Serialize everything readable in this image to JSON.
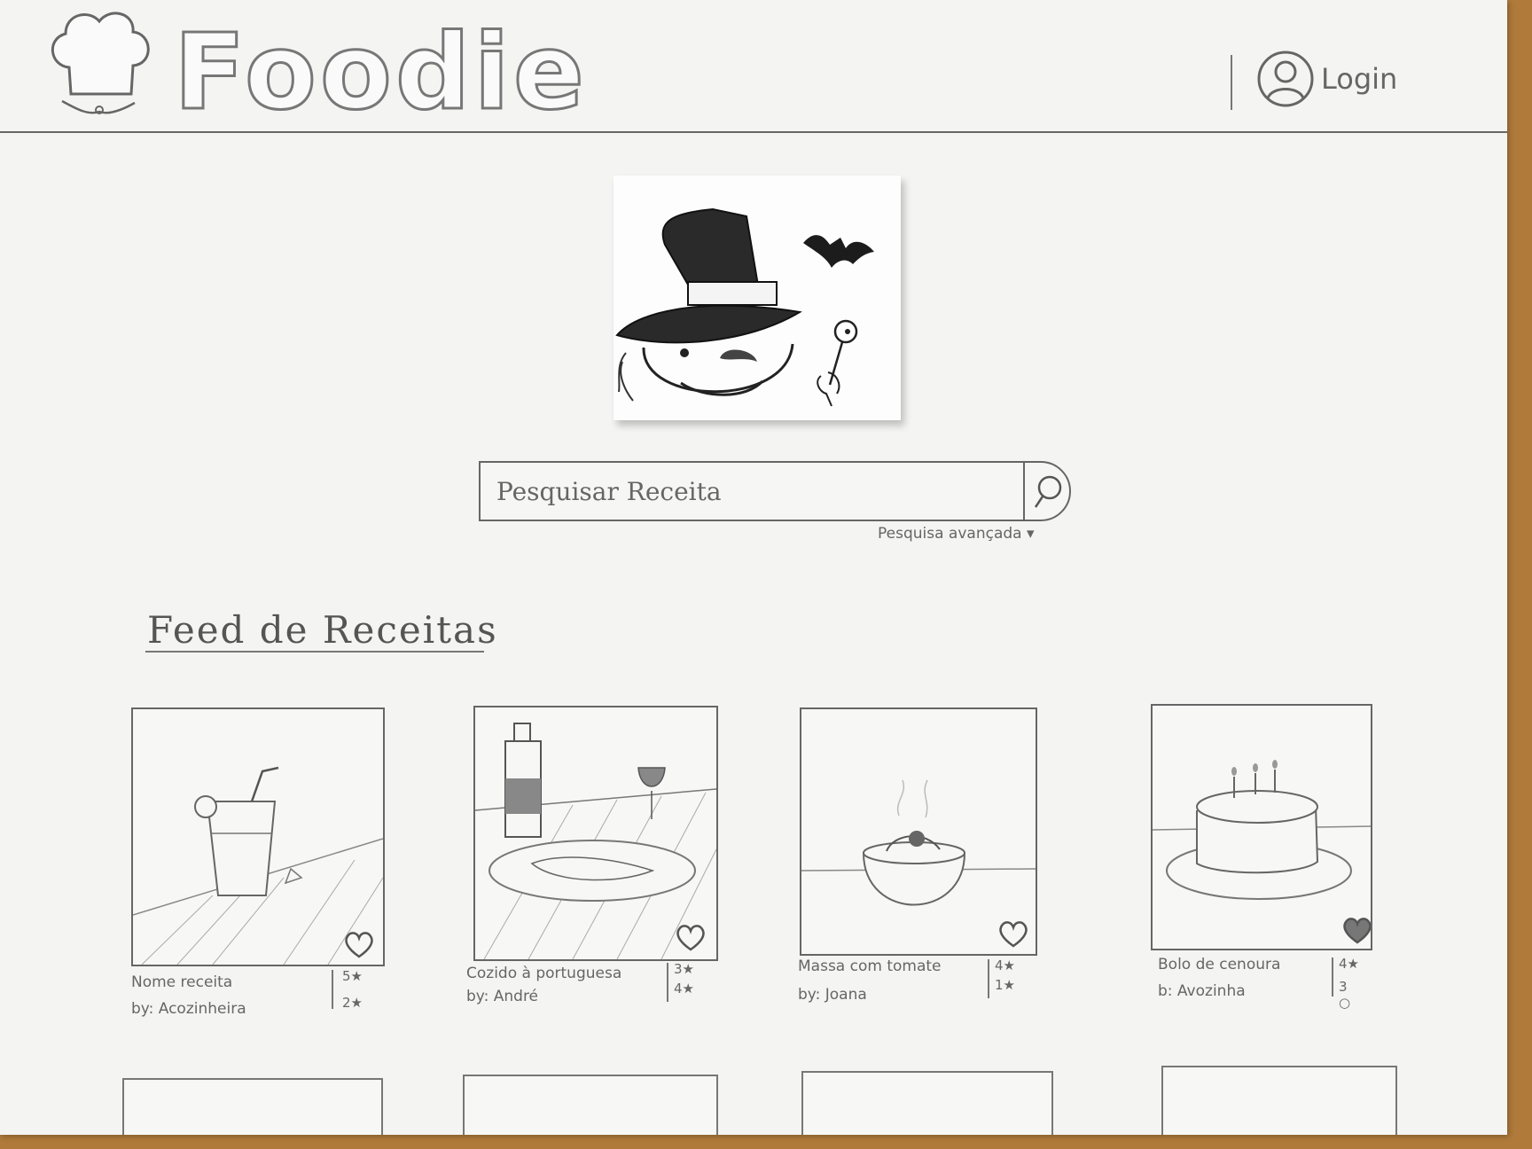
{
  "header": {
    "brand": "Foodie",
    "login_label": "Login",
    "icons": {
      "logo": "chef-hat-icon",
      "user": "user-circle-icon"
    }
  },
  "hero": {
    "image": "witch-character-illustration"
  },
  "search": {
    "placeholder": "Pesquisar Receita",
    "advanced_label": "Pesquisa avançada ▾",
    "icon": "search-icon"
  },
  "feed": {
    "title": "Feed de Receitas",
    "recipes": [
      {
        "name": "Nome receita",
        "author": "by: Acozinheira",
        "stat1": "5★",
        "stat2": "2★",
        "favorited": false,
        "image": "drink-glass"
      },
      {
        "name": "Cozido à portuguesa",
        "author": "by: André",
        "stat1": "3★",
        "stat2": "4★",
        "favorited": false,
        "image": "wine-and-plate"
      },
      {
        "name": "Massa com tomate",
        "author": "by: Joana",
        "stat1": "4★",
        "stat2": "1★",
        "favorited": false,
        "image": "pasta-bowl"
      },
      {
        "name": "Bolo de cenoura",
        "author": "b: Avozinha",
        "stat1": "4★",
        "stat2": "3 ○",
        "favorited": true,
        "image": "birthday-cake"
      }
    ]
  },
  "colors": {
    "paper": "#f4f4f3",
    "pencil": "#666666",
    "table": "#b07a3a"
  }
}
